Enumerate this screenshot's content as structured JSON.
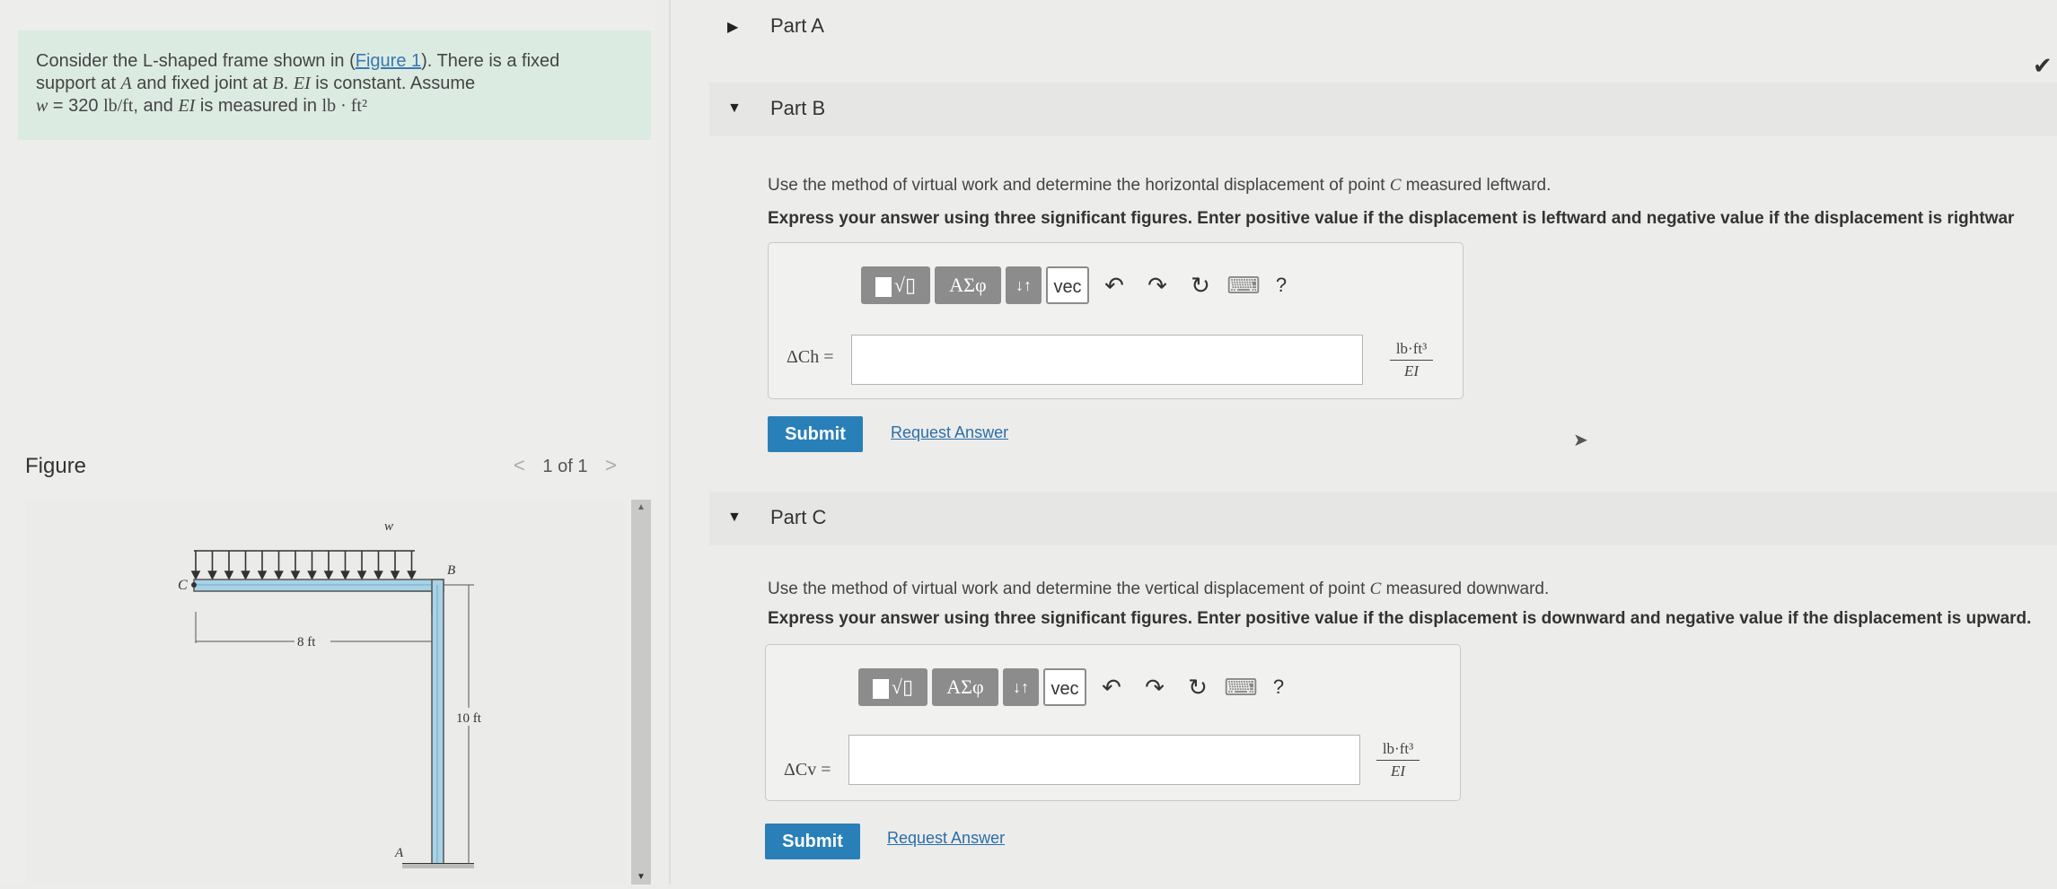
{
  "problem": {
    "line1": "Consider the L-shaped frame shown in (",
    "figure_link": "Figure 1",
    "line1_end": "). There is a fixed",
    "line2_a": "support at ",
    "A": "A",
    "line2_b": " and fixed joint at ",
    "B": "B",
    "line2_c": ". ",
    "EI": "EI",
    "line2_d": " is constant. Assume",
    "w_sym": "w",
    "w_val": " = 320 ",
    "w_unit": "lb/ft",
    "line3_b": ", and ",
    "EI2": "EI",
    "line3_c": " is measured in ",
    "ei_unit": "lb · ft²"
  },
  "figure": {
    "heading": "Figure",
    "pager_prev": "<",
    "pager_text": "1 of 1",
    "pager_next": ">",
    "labels": {
      "w": "w",
      "C": "C",
      "B": "B",
      "A": "A",
      "dim_horizontal": "8 ft",
      "dim_vertical": "10 ft"
    }
  },
  "partA": {
    "title": "Part A"
  },
  "partB": {
    "title": "Part B",
    "instruction": "Use the method of virtual work and determine the horizontal displacement of point C measured leftward.",
    "instruction_pre": "Use the method of virtual work and determine the horizontal displacement of point ",
    "instruction_var": "C",
    "instruction_post": " measured leftward.",
    "bold_instruction": "Express your answer using three significant figures. Enter positive value if the displacement is leftward and negative value if the displacement is rightwar",
    "answer_label": "ΔCh =",
    "answer_value": "",
    "unit_num": "lb·ft³",
    "unit_den": "EI",
    "submit": "Submit",
    "request": "Request Answer"
  },
  "partC": {
    "title": "Part C",
    "instruction_pre": "Use the method of virtual work and determine the vertical displacement of point ",
    "instruction_var": "C",
    "instruction_post": " measured downward.",
    "bold_instruction": "Express your answer using three significant figures. Enter positive value if the displacement is downward and negative value if the displacement is upward.",
    "answer_label": "ΔCv =",
    "answer_value": "",
    "unit_num": "lb·ft³",
    "unit_den": "EI",
    "submit": "Submit",
    "request": "Request Answer"
  },
  "toolbar": {
    "templates_icon": "template-icon",
    "greek": "ΑΣφ",
    "arrows": "↓↑",
    "vec": "vec",
    "undo": "↶",
    "redo": "↷",
    "reset": "↻",
    "keyboard": "⌨",
    "help": "?"
  },
  "colors": {
    "submit": "#2980b9",
    "link": "#2a6ea8",
    "problem_bg": "#dcebe2",
    "frame_member": "#a8d3e6"
  }
}
